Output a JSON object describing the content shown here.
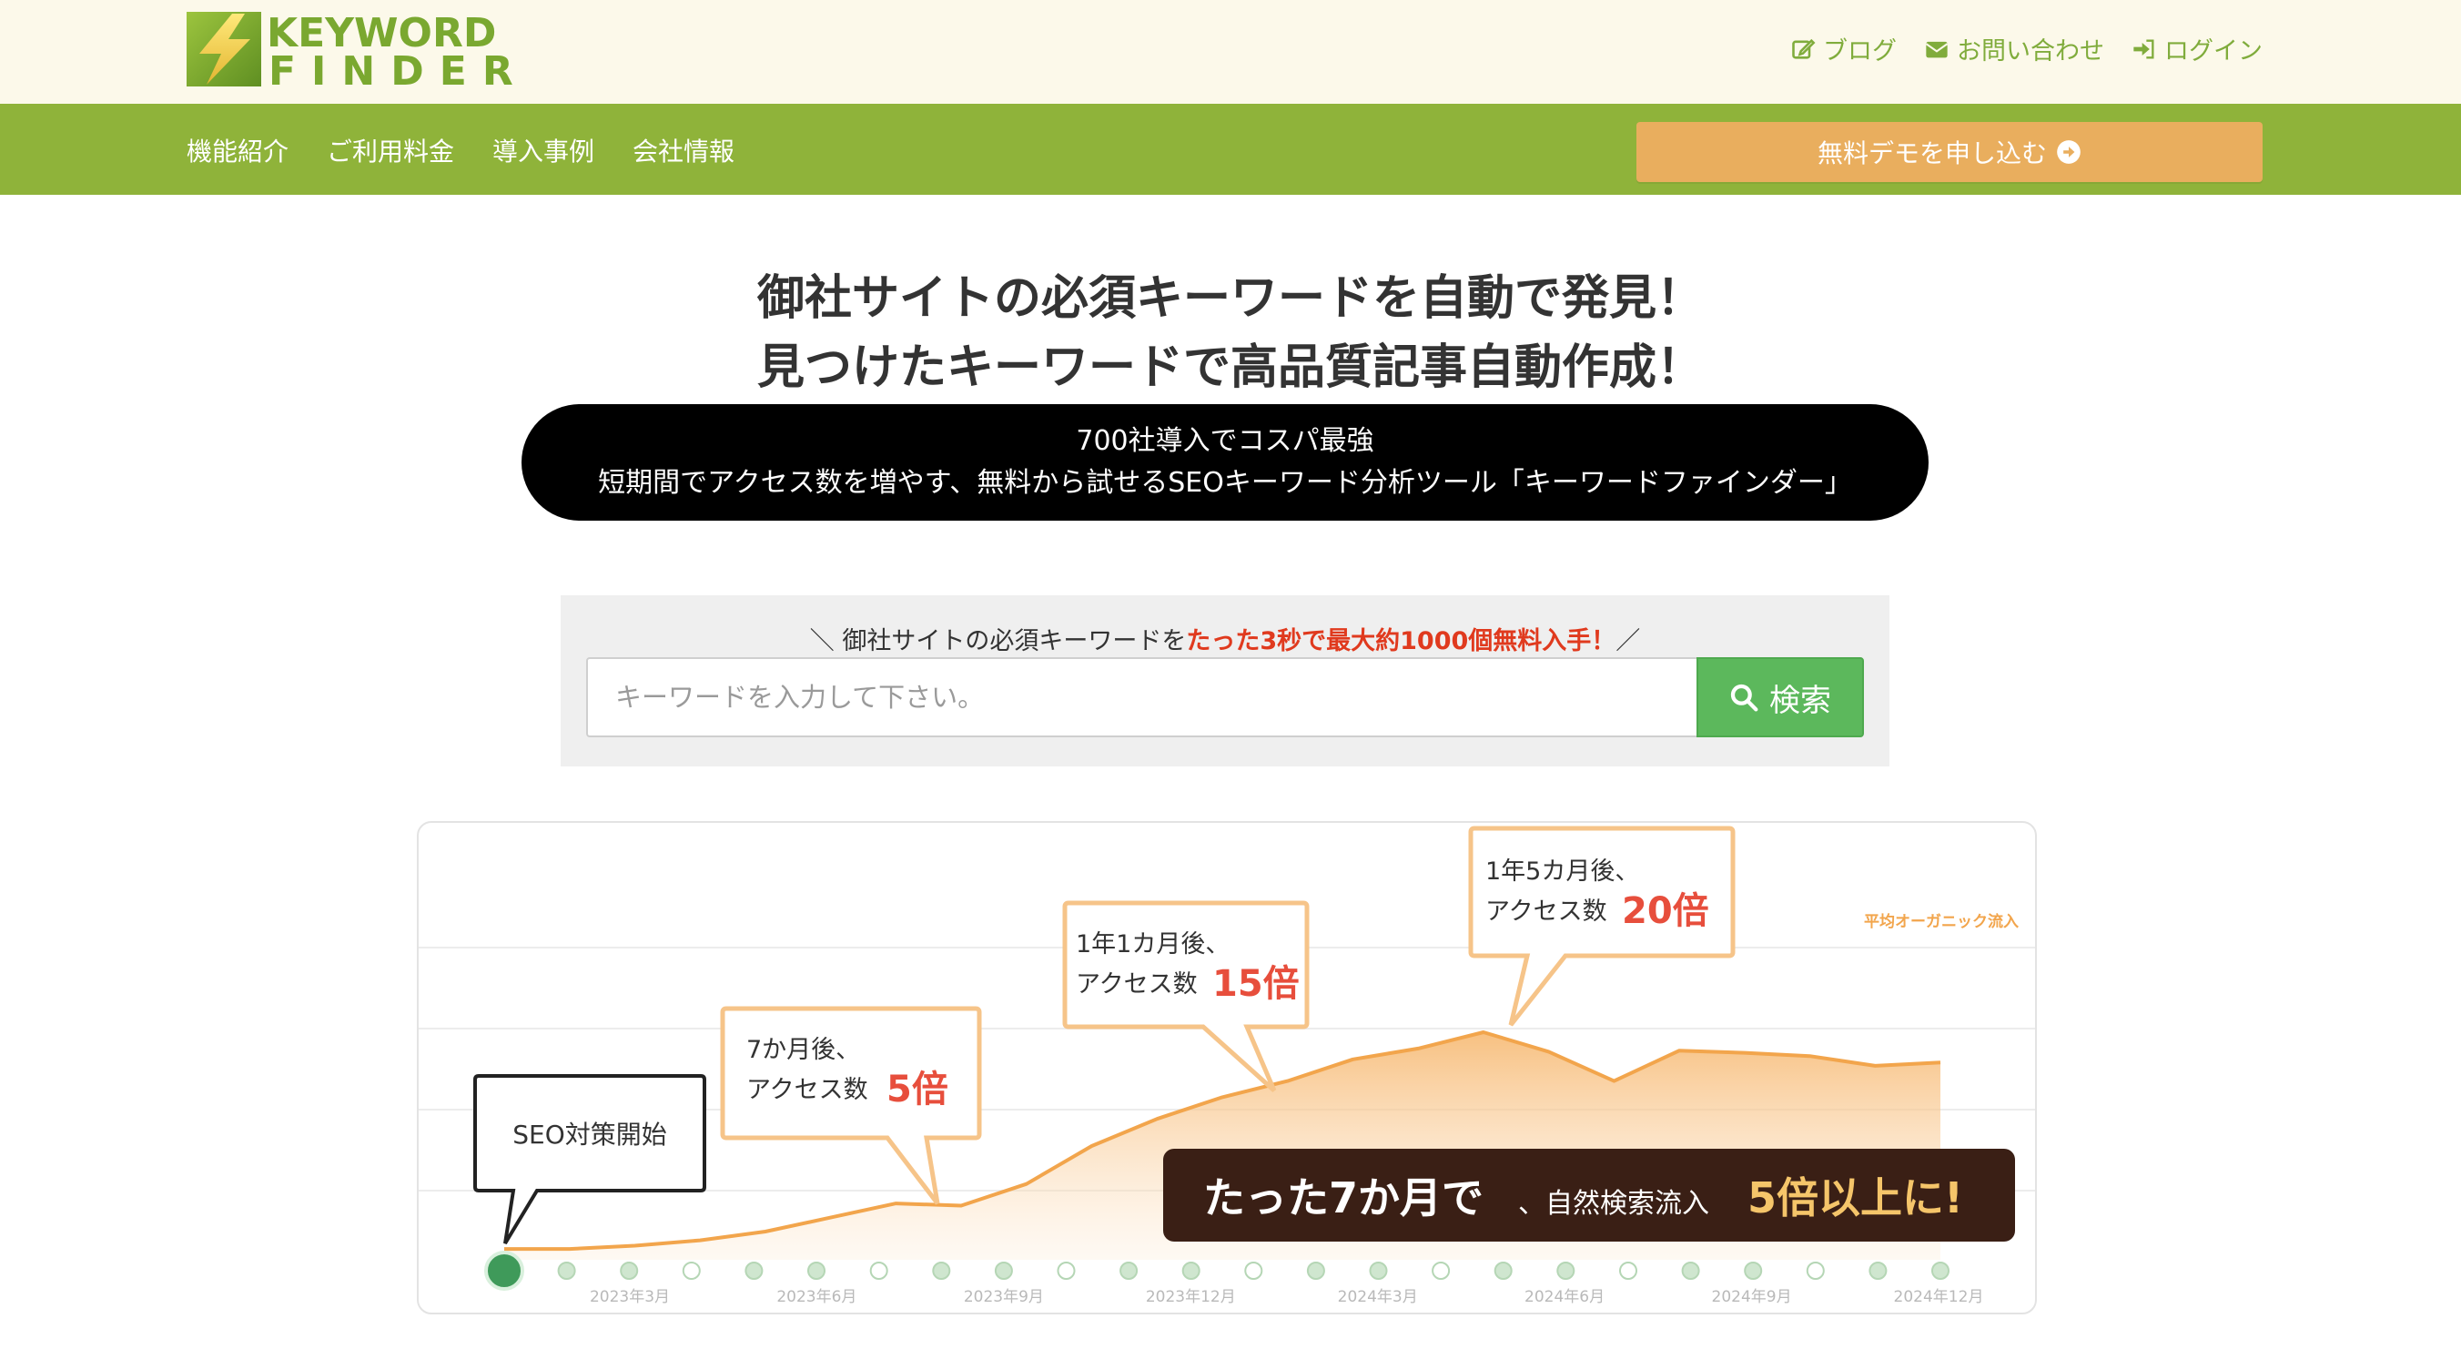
{
  "logo": {
    "line1": "KEYWORD",
    "line2": "FINDER",
    "icon": "lightning-bolt-logo"
  },
  "toplinks": [
    {
      "label": "ブログ",
      "icon": "edit-icon"
    },
    {
      "label": "お問い合わせ",
      "icon": "envelope-icon"
    },
    {
      "label": "ログイン",
      "icon": "sign-in-icon"
    }
  ],
  "nav": {
    "items": [
      "機能紹介",
      "ご利用料金",
      "導入事例",
      "会社情報"
    ],
    "demo_button": "無料デモを申し込む",
    "demo_icon": "arrow-circle-right-icon"
  },
  "hero": {
    "line1": "御社サイトの必須キーワードを自動で発見！",
    "line2": "見つけたキーワードで高品質記事自動作成！",
    "pill_line1": "700社導入でコスパ最強",
    "pill_line2": "短期間でアクセス数を増やす、無料から試せるSEOキーワード分析ツール「キーワードファインダー」"
  },
  "search": {
    "caption_pre": "＼ 御社サイトの必須キーワードを",
    "caption_highlight": "たった3秒で最大約1000個無料入手！",
    "caption_post": "／",
    "placeholder": "キーワードを入力して下さい。",
    "value": "",
    "button_label": "検索",
    "button_icon": "search-icon"
  },
  "banner": {
    "legend": "平均オーガニック流入",
    "start_label": "SEO対策開始",
    "callouts": [
      {
        "line1": "7か月後、",
        "line2a": "アクセス数",
        "line2b": "5倍"
      },
      {
        "line1": "1年1カ月後、",
        "line2a": "アクセス数",
        "line2b": "15倍"
      },
      {
        "line1": "1年5カ月後、",
        "line2a": "アクセス数",
        "line2b": "20倍"
      }
    ],
    "summary_a": "たった7か月で",
    "summary_b": "、自然検索流入",
    "summary_c": "5倍以上に!",
    "x_labels": [
      "2023年3月",
      "2023年6月",
      "2023年9月",
      "2023年12月",
      "2024年3月",
      "2024年6月",
      "2024年9月",
      "2024年12月"
    ],
    "series_values": [
      1,
      1,
      1.3,
      1.8,
      2.6,
      3.9,
      5.2,
      5,
      7,
      10.5,
      13,
      15,
      16.5,
      18.5,
      19.5,
      21,
      19.2,
      16.5,
      19.3,
      19.1,
      18.8,
      17.9,
      18.2
    ],
    "colors": {
      "accent": "#f2a54c",
      "red": "#e74e3c",
      "dark": "#3a1f15",
      "green": "#8fb33a",
      "orange_btn": "#e9ae5e"
    }
  }
}
